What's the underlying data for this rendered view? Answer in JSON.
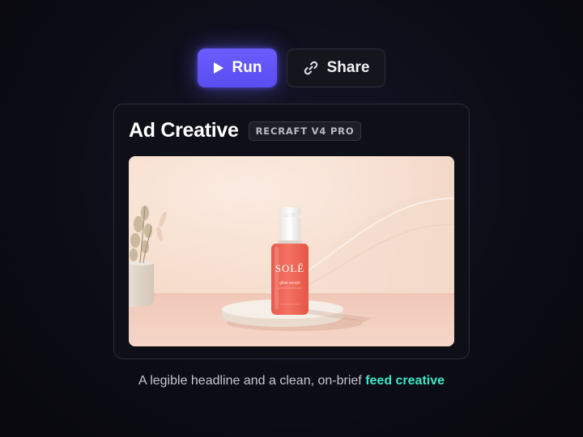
{
  "toolbar": {
    "run_label": "Run",
    "share_label": "Share",
    "run_icon": "play-icon",
    "share_icon": "link-icon",
    "run_color": "#6a5cff"
  },
  "card": {
    "title": "Ad Creative",
    "model_badge": "RECRAFT V4 PRO",
    "image": {
      "brand_text": "SOLÉ",
      "product_line": "glow serum"
    }
  },
  "caption": {
    "text": "A legible headline and a clean, on-brief",
    "highlight": "feed creative",
    "highlight_color": "#3ee6c4"
  }
}
